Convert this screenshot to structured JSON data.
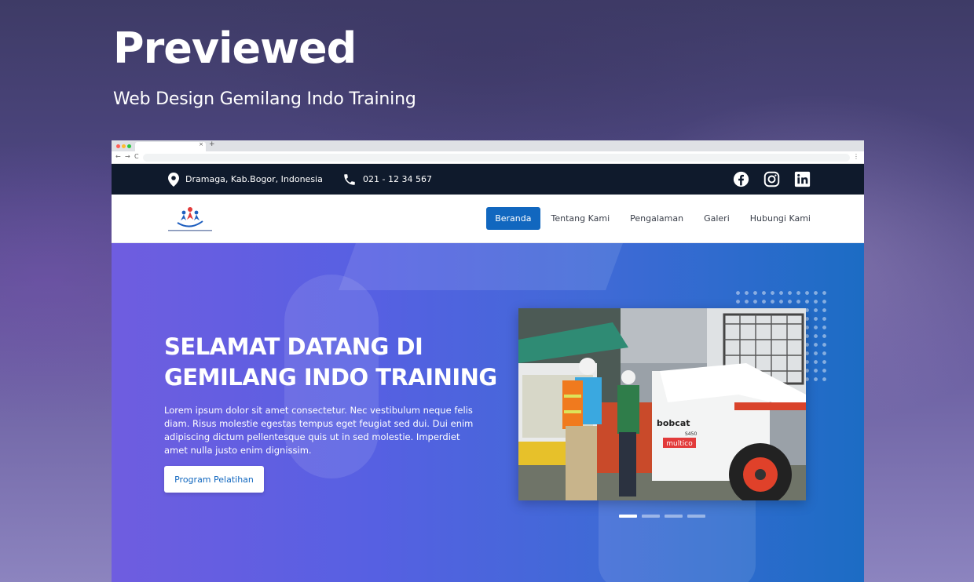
{
  "showcase": {
    "title": "Previewed",
    "subtitle": "Web Design Gemilang Indo Training"
  },
  "browser": {
    "tab_close": "×",
    "new_tab": "+",
    "nav_back": "←",
    "nav_forward": "→",
    "nav_reload": "C",
    "menu": "⋮"
  },
  "topbar": {
    "location": "Dramaga, Kab.Bogor, Indonesia",
    "phone": "021 - 12 34 567",
    "social": [
      "facebook-icon",
      "instagram-icon",
      "linkedin-icon"
    ]
  },
  "navbar": {
    "links": [
      "Beranda",
      "Tentang Kami",
      "Pengalaman",
      "Galeri",
      "Hubungi Kami"
    ],
    "active": "Beranda"
  },
  "hero": {
    "heading": "SELAMAT DATANG DI GEMILANG INDO TRAINING",
    "paragraph": "Lorem ipsum dolor sit amet consectetur. Nec vestibulum neque felis diam. Risus molestie egestas tempus eget feugiat sed dui. Dui enim adipiscing dictum pellentesque quis ut in sed molestie. Imperdiet amet nulla justo enim dignissim.",
    "cta_label": "Program Pelatihan",
    "carousel_count": 4,
    "carousel_active": 1
  },
  "photo": {
    "machine_brand": "bobcat",
    "machine_label": "multico",
    "machine_code": "S450"
  },
  "colors": {
    "primary": "#1167bf",
    "topbar_bg": "#0f1a2c",
    "hero_gradient_start": "#6f5de0",
    "hero_gradient_end": "#1c6cc4"
  }
}
